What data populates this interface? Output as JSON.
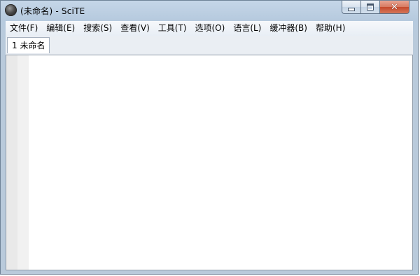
{
  "window": {
    "title": "(未命名) - SciTE"
  },
  "icons": {
    "app": "scite-app-icon",
    "minimize": "minimize-icon",
    "maximize": "maximize-icon",
    "close": "close-icon"
  },
  "caption": {
    "close_glyph": "✕"
  },
  "menu": {
    "items": [
      {
        "label": "文件(F)"
      },
      {
        "label": "编辑(E)"
      },
      {
        "label": "搜索(S)"
      },
      {
        "label": "查看(V)"
      },
      {
        "label": "工具(T)"
      },
      {
        "label": "选项(O)"
      },
      {
        "label": "语言(L)"
      },
      {
        "label": "缓冲器(B)"
      },
      {
        "label": "帮助(H)"
      }
    ]
  },
  "tabs": [
    {
      "label": "1 未命名",
      "active": true
    }
  ],
  "editor": {
    "content": ""
  },
  "colors": {
    "close_button": "#c5492c",
    "frame": "#b6cade"
  }
}
